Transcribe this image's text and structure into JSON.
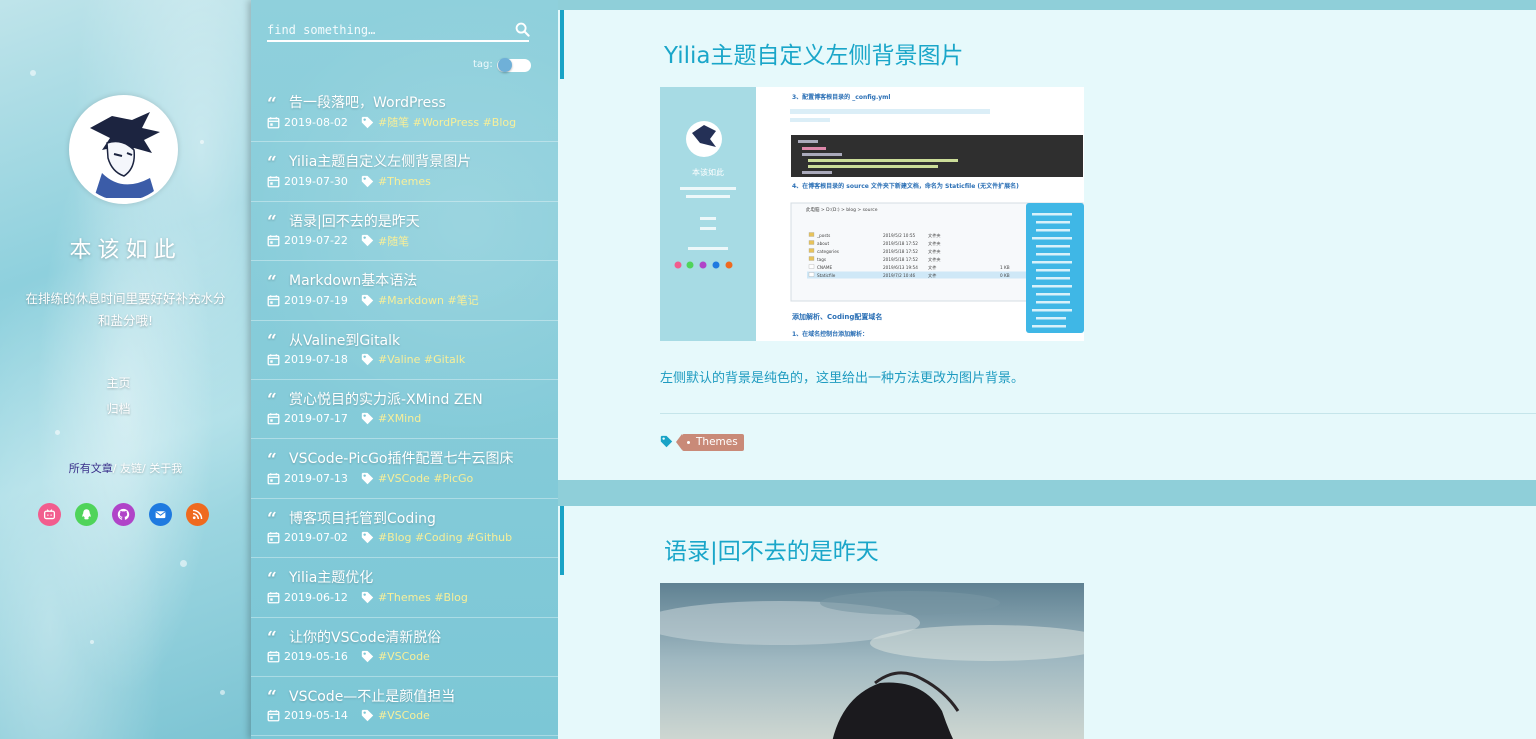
{
  "profile": {
    "title": "本该如此",
    "motto": "在排练的休息时间里要好好补充水分和盐分哦!",
    "nav": [
      "主页",
      "归档"
    ],
    "links": {
      "active": "所有文章",
      "rest": "/ 友链/ 关于我"
    },
    "social": [
      {
        "icon": "bilibili-icon",
        "color": "#f25d8e"
      },
      {
        "icon": "qq-icon",
        "color": "#4fd45a"
      },
      {
        "icon": "github-icon",
        "color": "#b044c8"
      },
      {
        "icon": "mail-icon",
        "color": "#1f7ae0"
      },
      {
        "icon": "rss-icon",
        "color": "#ef6a1f"
      }
    ]
  },
  "search": {
    "placeholder": "find something…",
    "tag_label": "tag:"
  },
  "posts": [
    {
      "title": "告一段落吧，WordPress",
      "date": "2019-08-02",
      "tags": "#随笔 #WordPress #Blog"
    },
    {
      "title": "Yilia主题自定义左侧背景图片",
      "date": "2019-07-30",
      "tags": "#Themes"
    },
    {
      "title": "语录|回不去的是昨天",
      "date": "2019-07-22",
      "tags": "#随笔"
    },
    {
      "title": "Markdown基本语法",
      "date": "2019-07-19",
      "tags": "#Markdown #笔记"
    },
    {
      "title": "从Valine到Gitalk",
      "date": "2019-07-18",
      "tags": "#Valine #Gitalk"
    },
    {
      "title": "赏心悦目的实力派-XMind ZEN",
      "date": "2019-07-17",
      "tags": "#XMind"
    },
    {
      "title": "VSCode-PicGo插件配置七牛云图床",
      "date": "2019-07-13",
      "tags": "#VSCode #PicGo"
    },
    {
      "title": "博客项目托管到Coding",
      "date": "2019-07-02",
      "tags": "#Blog #Coding #Github"
    },
    {
      "title": "Yilia主题优化",
      "date": "2019-06-12",
      "tags": "#Themes #Blog"
    },
    {
      "title": "让你的VSCode清新脱俗",
      "date": "2019-05-16",
      "tags": "#VSCode"
    },
    {
      "title": "VSCode—不止是颜值担当",
      "date": "2019-05-14",
      "tags": "#VSCode"
    }
  ],
  "articles": [
    {
      "title": "Yilia主题自定义左侧背景图片",
      "summary": "左侧默认的背景是纯色的，这里给出一种方法更改为图片背景。",
      "tag": "Themes",
      "thumb": {
        "mini_title": "本该如此",
        "step3": "3、配置博客根目录的 _config.yml",
        "step4": "4、在博客根目录的 source 文件夹下新建文档，命名为 Staticfile (无文件扩展名)",
        "step5": "添加解析、Coding配置域名",
        "step5_sub": "1、在域名控制台添加解析：",
        "path": "此电脑 > D:(D:) > blog > source",
        "files": [
          {
            "name": "_posts",
            "date": "2019/5/2 10:55",
            "type": "文件夹",
            "size": ""
          },
          {
            "name": "about",
            "date": "2019/5/18 17:52",
            "type": "文件夹",
            "size": ""
          },
          {
            "name": "categories",
            "date": "2019/5/18 17:52",
            "type": "文件夹",
            "size": ""
          },
          {
            "name": "tags",
            "date": "2019/5/18 17:52",
            "type": "文件夹",
            "size": ""
          },
          {
            "name": "CNAME",
            "date": "2019/6/13 19:54",
            "type": "文件",
            "size": "1 KB"
          },
          {
            "name": "Staticfile",
            "date": "2019/7/2 10:46",
            "type": "文件",
            "size": "0 KB"
          }
        ]
      }
    },
    {
      "title": "语录|回不去的是昨天"
    }
  ]
}
